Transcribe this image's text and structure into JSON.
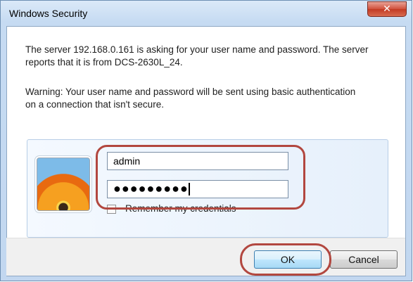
{
  "window": {
    "title": "Windows Security",
    "close_glyph": "✕"
  },
  "message": {
    "line1": "The server 192.168.0.161 is asking for your user name and password. The server reports that it is from DCS-2630L_24.",
    "warning": "Warning: Your user name and password will be sent using basic authentication on a connection that isn't secure."
  },
  "credentials": {
    "username_value": "admin",
    "password_value": "●●●●●●●●●",
    "remember_label": "Remember my credentials",
    "remember_checked": false,
    "avatar_icon": "user-tile-flower-icon"
  },
  "buttons": {
    "ok_label": "OK",
    "cancel_label": "Cancel"
  },
  "colors": {
    "highlight": "#b2473f",
    "close_button": "#c9462f",
    "title_bar": "#c6dbf2"
  }
}
